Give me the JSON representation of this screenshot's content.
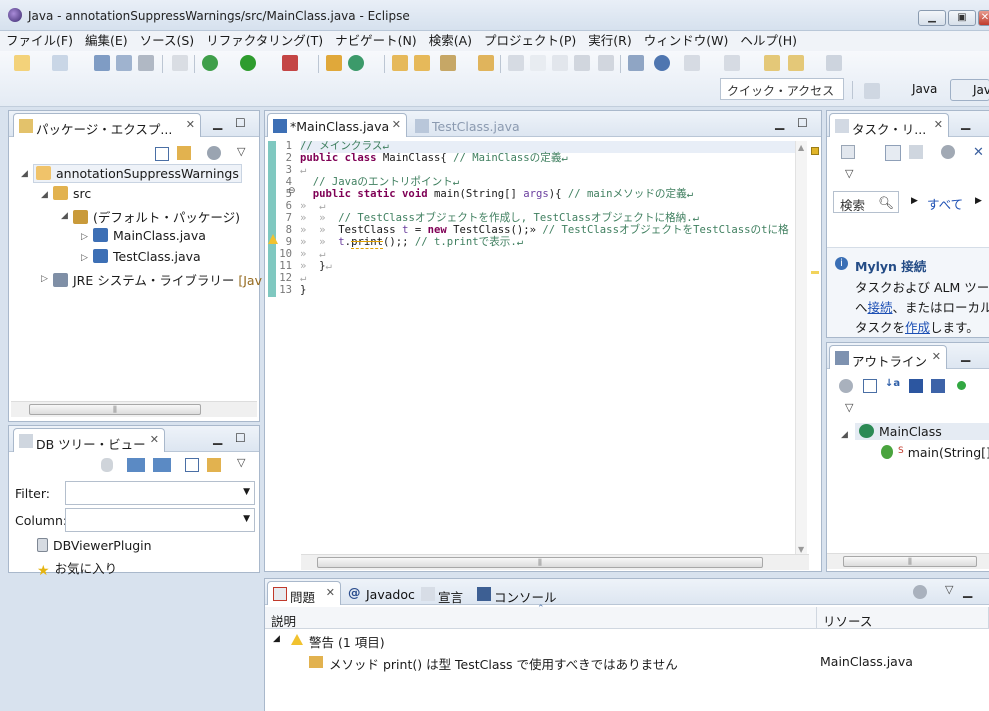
{
  "window": {
    "title": "Java - annotationSuppressWarnings/src/MainClass.java - Eclipse",
    "controls": {
      "minimize": "▁",
      "maximize": "▣",
      "close": "✕"
    }
  },
  "menu": [
    "ファイル(F)",
    "編集(E)",
    "ソース(S)",
    "リファクタリング(T)",
    "ナビゲート(N)",
    "検索(A)",
    "プロジェクト(P)",
    "実行(R)",
    "ウィンドウ(W)",
    "ヘルプ(H)"
  ],
  "toolbar": {
    "quick_access": "クイック・アクセス",
    "perspectives": [
      "Java",
      "Java"
    ]
  },
  "package_explorer": {
    "tab": "パッケージ・エクスプ...",
    "items": [
      "annotationSuppressWarnings",
      "src",
      "(デフォルト・パッケージ)",
      "MainClass.java",
      "TestClass.java",
      "JRE システム・ライブラリー",
      "[Jav"
    ]
  },
  "db_tree": {
    "tab": "DB ツリー・ビュー",
    "filter_label": "Filter:",
    "column_label": "Column:",
    "items": [
      "DBViewerPlugin",
      "お気に入り"
    ]
  },
  "editor": {
    "tabs": [
      "*MainClass.java",
      "TestClass.java"
    ],
    "line_numbers": [
      "1",
      "2",
      "3",
      "4",
      "5",
      "6",
      "7",
      "8",
      "9",
      "10",
      "11",
      "12",
      "13"
    ]
  },
  "task_list": {
    "tab": "タスク・リ...",
    "search": "検索",
    "all": "すべて",
    "mylyn_title": "Mylyn 接続",
    "mylyn_lines": [
      "タスクおよび ALM ツール",
      "へ",
      "接続",
      "、またはローカル",
      "タスクを",
      "作成",
      "します。"
    ]
  },
  "outline": {
    "tab": "アウトライン",
    "items": [
      "MainClass",
      "main(String[]"
    ]
  },
  "bottom": {
    "tabs": [
      "問題",
      "Javadoc",
      "宣言",
      "コンソール"
    ],
    "columns": [
      "説明",
      "リソース"
    ],
    "group": "警告 (1 項目)",
    "row_text": "メソッド print() は型 TestClass で使用すべきではありません",
    "row_resource": "MainClass.java"
  },
  "colors": {
    "chrome": "#d8e2ee",
    "keyword": "#7f0055",
    "comment": "#3f7f5f",
    "link": "#1c4fb4"
  }
}
